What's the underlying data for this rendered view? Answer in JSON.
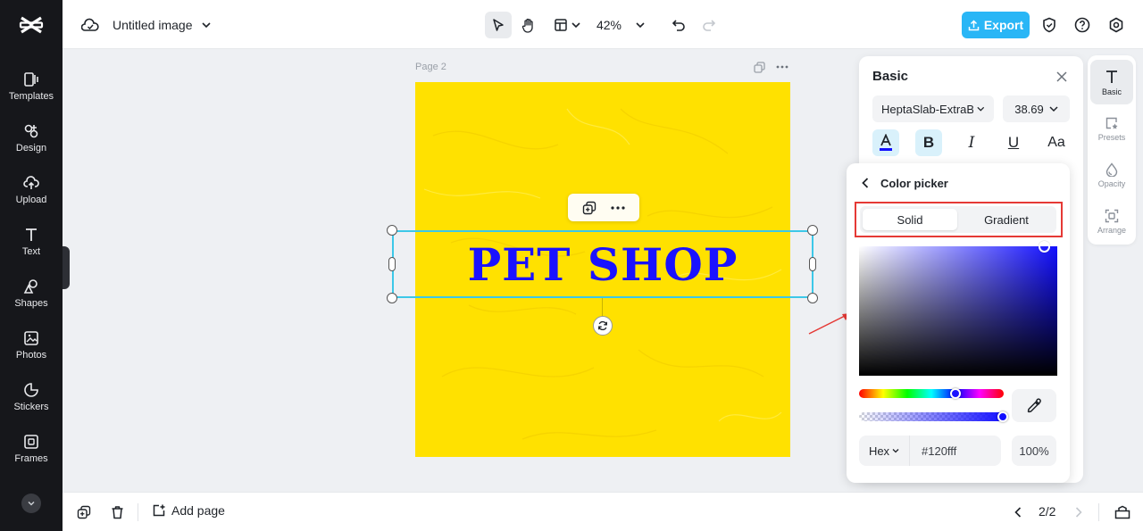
{
  "sidebar": {
    "items": [
      {
        "label": "Templates",
        "icon": "templates-icon"
      },
      {
        "label": "Design",
        "icon": "design-icon"
      },
      {
        "label": "Upload",
        "icon": "upload-icon"
      },
      {
        "label": "Text",
        "icon": "text-icon"
      },
      {
        "label": "Shapes",
        "icon": "shapes-icon"
      },
      {
        "label": "Photos",
        "icon": "photos-icon"
      },
      {
        "label": "Stickers",
        "icon": "stickers-icon"
      },
      {
        "label": "Frames",
        "icon": "frames-icon"
      }
    ]
  },
  "topbar": {
    "doc_title": "Untitled image",
    "zoom": "42%",
    "export_label": "Export"
  },
  "canvas": {
    "page_label": "Page 2",
    "headline": "PET SHOP",
    "background_color": "#ffe100",
    "text_color": "#1a12ff"
  },
  "bottombar": {
    "add_page_label": "Add page",
    "pager": "2/2"
  },
  "rail": {
    "items": [
      {
        "label": "Basic",
        "active": true
      },
      {
        "label": "Presets"
      },
      {
        "label": "Opacity"
      },
      {
        "label": "Arrange"
      }
    ]
  },
  "basic_panel": {
    "title": "Basic",
    "font": "HeptaSlab-ExtraBold",
    "size": "38.69",
    "format": {
      "bold": "B",
      "italic": "I",
      "underline": "U",
      "case": "Aa"
    }
  },
  "color_picker": {
    "title": "Color picker",
    "tabs": [
      "Solid",
      "Gradient"
    ],
    "active_tab": "Solid",
    "mode": "Hex",
    "hex": "#120fff",
    "opacity": "100%",
    "accent": "#120fff"
  }
}
